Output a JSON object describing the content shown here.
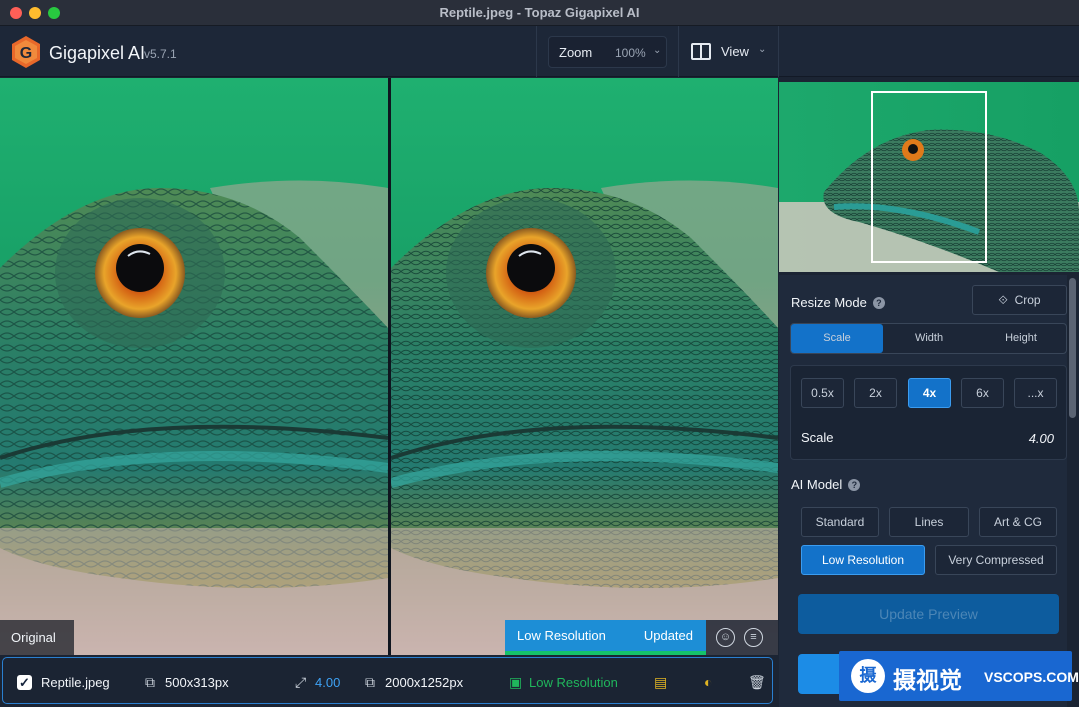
{
  "window": {
    "title": "Reptile.jpeg - Topaz Gigapixel AI"
  },
  "header": {
    "app_name": "Gigapixel AI",
    "version": "v5.7.1",
    "zoom_label": "Zoom",
    "zoom_value": "100%",
    "view_label": "View"
  },
  "preview": {
    "original_label": "Original",
    "status_model": "Low Resolution",
    "status_state": "Updated",
    "status_color": "#1d8ed6"
  },
  "file": {
    "name": "Reptile.jpeg",
    "input_size": "500x313px",
    "scale": "4.00",
    "output_size": "2000x1252px",
    "model": "Low Resolution",
    "checked": true
  },
  "panel": {
    "resize_mode_title": "Resize Mode",
    "crop_label": "Crop",
    "modes": [
      "Scale",
      "Width",
      "Height"
    ],
    "active_mode": "Scale",
    "scale_presets": [
      "0.5x",
      "2x",
      "4x",
      "6x",
      "...x"
    ],
    "active_preset": "4x",
    "scale_label": "Scale",
    "scale_value": "4.00",
    "ai_model_title": "AI Model",
    "models_row1": [
      "Standard",
      "Lines",
      "Art & CG"
    ],
    "models_row2": [
      "Low Resolution",
      "Very Compressed"
    ],
    "active_model": "Low Resolution",
    "update_preview": "Update Preview"
  },
  "watermark": {
    "brand": "摄视觉",
    "domain": "VSCOPS.COM",
    "logo_char": "摄"
  },
  "colors": {
    "accent": "#1372c9",
    "success": "#20b65c",
    "background": "#1b2433"
  }
}
